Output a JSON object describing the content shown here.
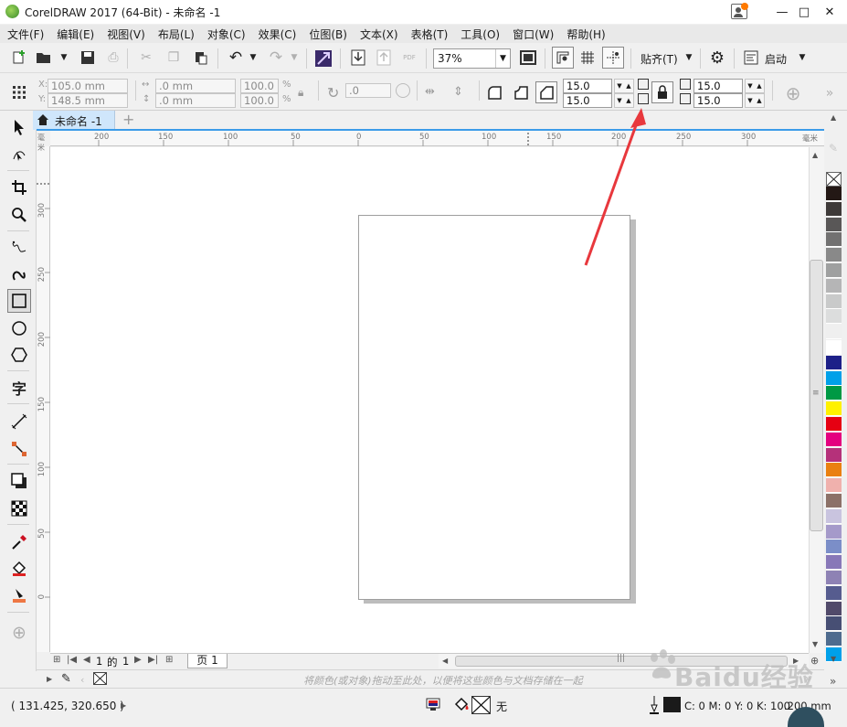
{
  "window": {
    "title": "CorelDRAW 2017 (64-Bit) - 未命名 -1",
    "minimize": "—",
    "maximize": "□",
    "close": "✕"
  },
  "menu": [
    "文件(F)",
    "编辑(E)",
    "视图(V)",
    "布局(L)",
    "对象(C)",
    "效果(C)",
    "位图(B)",
    "文本(X)",
    "表格(T)",
    "工具(O)",
    "窗口(W)",
    "帮助(H)"
  ],
  "toolbar": {
    "zoom": "37%",
    "snap_label": "贴齐(T)",
    "launch_label": "启动",
    "pdf_label": "PDF"
  },
  "property_bar": {
    "x": "105.0 mm",
    "y": "148.5 mm",
    "width": ".0 mm",
    "height": ".0 mm",
    "scale_x": "100.0",
    "scale_y": "100.0",
    "percent": "%",
    "rotation": ".0",
    "corner_tl": "15.0 mm",
    "corner_bl": "15.0 mm",
    "corner_tr": "15.0 mm",
    "corner_br": "15.0 mm"
  },
  "document": {
    "tab_label": "未命名 -1",
    "page_tab": "页 1",
    "page_current": "1",
    "page_of": "的",
    "page_total": "1"
  },
  "rulers": {
    "h_labels": [
      "200",
      "150",
      "100",
      "50",
      "0",
      "50",
      "100",
      "150",
      "200",
      "250",
      "300",
      "毫米"
    ],
    "v_labels": [
      "300",
      "250",
      "200",
      "150",
      "100",
      "50",
      "0"
    ],
    "corner_label": "毫米"
  },
  "palette": {
    "colors": [
      "#231815",
      "#3e3a39",
      "#595757",
      "#727171",
      "#898989",
      "#9fa0a0",
      "#b5b5b6",
      "#c9caca",
      "#dcdddd",
      "#efefef",
      "#ffffff",
      "#1d2088",
      "#00a0e9",
      "#009944",
      "#fff100",
      "#e60012",
      "#e4007f",
      "#b5317a",
      "#ea8010",
      "#f0b1ad",
      "#8c7168",
      "#c9c4df",
      "#a59aca",
      "#7b8ec8",
      "#8878b8",
      "#8e82b4",
      "#565c8f",
      "#514a6a",
      "#474f74",
      "#4e6b8e",
      "#00a0e9"
    ]
  },
  "doc_palette_hint": "将颜色(或对象)拖动至此处，以便将这些颜色与文档存储在一起",
  "status": {
    "coords": "( 131.425, 320.650 )",
    "fill_none": "无",
    "outline_color": "C: 0 M: 0 Y: 0 K: 100",
    "outline_width": ".200 mm"
  },
  "watermark": {
    "text": "Baidu经验"
  }
}
